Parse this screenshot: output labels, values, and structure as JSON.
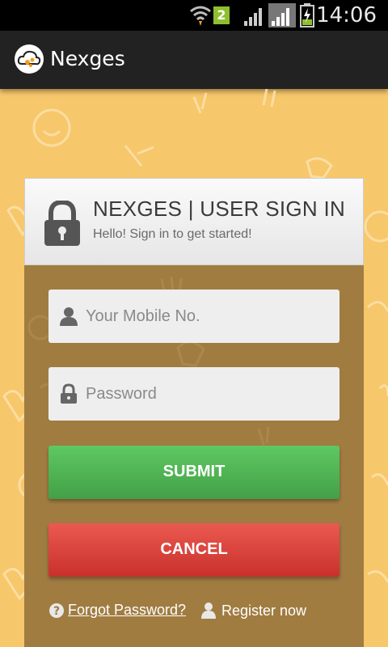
{
  "status_bar": {
    "time": "14:06",
    "sim_badge": "2",
    "icons": [
      "wifi-icon",
      "signal-icon",
      "signal-icon",
      "battery-charging-icon"
    ]
  },
  "action_bar": {
    "title": "Nexges",
    "logo_icon": "cloud-logo-icon"
  },
  "login_card": {
    "title": "NEXGES | USER SIGN IN",
    "subtitle": "Hello! Sign in to get started!",
    "header_icon": "lock-icon",
    "mobile_field": {
      "placeholder": "Your Mobile No.",
      "value": "",
      "icon": "user-icon"
    },
    "password_field": {
      "placeholder": "Password",
      "value": "",
      "icon": "padlock-icon"
    },
    "submit_label": "SUBMIT",
    "cancel_label": "CANCEL",
    "forgot_label": "Forgot Password?",
    "register_label": "Register now"
  },
  "colors": {
    "background": "#f7c76b",
    "card": "#a07c41",
    "submit": "#4caf50",
    "cancel": "#d9433a",
    "action_bar": "#222222"
  }
}
